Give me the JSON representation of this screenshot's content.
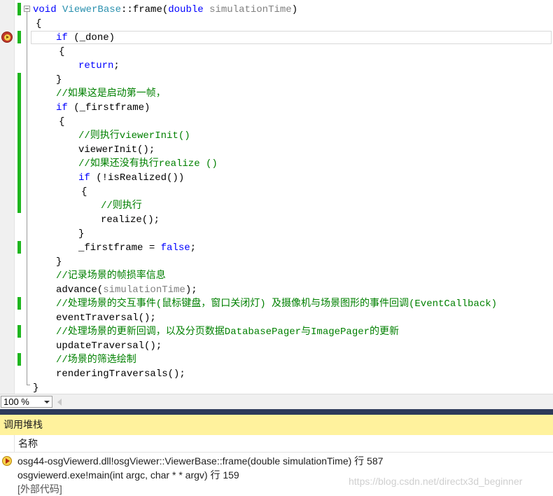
{
  "editor": {
    "lines": [
      [
        {
          "t": "void ",
          "c": "kw"
        },
        {
          "t": "ViewerBase",
          "c": "ty"
        },
        {
          "t": "::frame(",
          "c": "tx"
        },
        {
          "t": "double ",
          "c": "kw"
        },
        {
          "t": "simulationTime",
          "c": "pm"
        },
        {
          "t": ")",
          "c": "tx"
        }
      ],
      [
        {
          "t": "{",
          "c": "tx"
        }
      ],
      [
        {
          "t": "if",
          "c": "kw"
        },
        {
          "t": " (_done)",
          "c": "tx"
        }
      ],
      [
        {
          "t": "{",
          "c": "tx"
        }
      ],
      [
        {
          "t": "return",
          "c": "kw"
        },
        {
          "t": ";",
          "c": "tx"
        }
      ],
      [
        {
          "t": "}",
          "c": "tx"
        }
      ],
      [
        {
          "t": "//如果这是启动第一帧，",
          "c": "cm"
        }
      ],
      [
        {
          "t": "if",
          "c": "kw"
        },
        {
          "t": " (_firstframe)",
          "c": "tx"
        }
      ],
      [
        {
          "t": "{",
          "c": "tx"
        }
      ],
      [
        {
          "t": "//则执行viewerInit()",
          "c": "cm"
        }
      ],
      [
        {
          "t": "viewerInit();",
          "c": "tx"
        }
      ],
      [
        {
          "t": "//如果还没有执行realize ()",
          "c": "cm"
        }
      ],
      [
        {
          "t": "if",
          "c": "kw"
        },
        {
          "t": " (!isRealized())",
          "c": "tx"
        }
      ],
      [
        {
          "t": "{",
          "c": "tx"
        }
      ],
      [
        {
          "t": "//则执行",
          "c": "cm"
        }
      ],
      [
        {
          "t": "realize();",
          "c": "tx"
        }
      ],
      [
        {
          "t": "}",
          "c": "tx"
        }
      ],
      [
        {
          "t": "_firstframe = ",
          "c": "tx"
        },
        {
          "t": "false",
          "c": "kw"
        },
        {
          "t": ";",
          "c": "tx"
        }
      ],
      [
        {
          "t": "}",
          "c": "tx"
        }
      ],
      [
        {
          "t": "//记录场景的帧损率信息",
          "c": "cm"
        }
      ],
      [
        {
          "t": "advance(",
          "c": "tx"
        },
        {
          "t": "simulationTime",
          "c": "pm"
        },
        {
          "t": ");",
          "c": "tx"
        }
      ],
      [
        {
          "t": "//处理场景的交互事件(鼠标键盘，窗口关闭灯) 及摄像机与场景图形的事件回调(EventCallback)",
          "c": "cm"
        }
      ],
      [
        {
          "t": "eventTraversal();",
          "c": "tx"
        }
      ],
      [
        {
          "t": "//处理场景的更新回调，以及分页数据DatabasePager与ImagePager的更新",
          "c": "cm"
        }
      ],
      [
        {
          "t": "updateTraversal();",
          "c": "tx"
        }
      ],
      [
        {
          "t": "//场景的筛选绘制",
          "c": "cm"
        }
      ],
      [
        {
          "t": "renderingTraversals();",
          "c": "tx"
        }
      ],
      [
        {
          "t": "}",
          "c": "tx"
        }
      ]
    ]
  },
  "zoom": {
    "value": "100 %"
  },
  "call_stack": {
    "title": "调用堆栈",
    "column_name": "名称",
    "rows": [
      {
        "text": "osg44-osgViewerd.dll!osgViewer::ViewerBase::frame(double simulationTime) 行 587",
        "current": true
      },
      {
        "text": "osgviewerd.exe!main(int argc, char * * argv) 行 159",
        "current": false
      },
      {
        "text": "[外部代码]",
        "current": false
      }
    ],
    "watermark": "https://blog.csdn.net/directx3d_beginner"
  },
  "colors": {
    "keyword": "#0000ff",
    "type": "#2b91af",
    "comment": "#008000",
    "param": "#808080",
    "change_bar": "#1fb61f",
    "panel_title_bg": "#fff29d"
  }
}
